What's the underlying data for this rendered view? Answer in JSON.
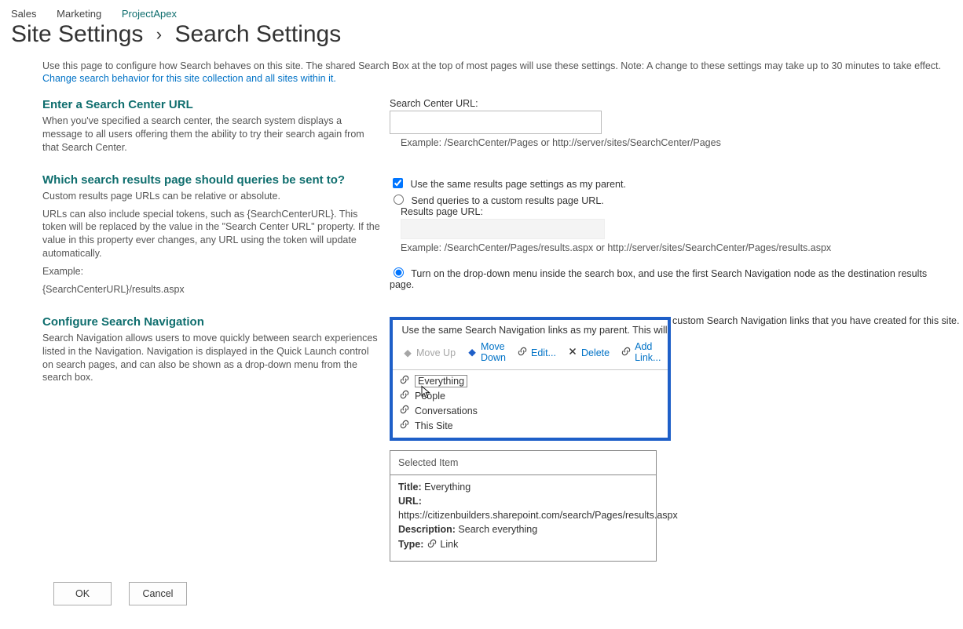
{
  "breadcrumbs": {
    "a": "Sales",
    "b": "Marketing",
    "c": "ProjectApex"
  },
  "title": {
    "main": "Site Settings",
    "sep": "›",
    "sub": "Search Settings"
  },
  "intro": {
    "line1": "Use this page to configure how Search behaves on this site. The shared Search Box at the top of most pages will use these settings. Note: A change to these settings may take up to 30 minutes to take effect.",
    "line2": "Change search behavior for this site collection and all sites within it."
  },
  "sec1": {
    "title": "Enter a Search Center URL",
    "text": "When you've specified a search center, the search system displays a message to all users offering them the ability to try their search again from that Search Center.",
    "fieldLabel": "Search Center URL:",
    "example": "Example: /SearchCenter/Pages or http://server/sites/SearchCenter/Pages"
  },
  "sec2": {
    "title": "Which search results page should queries be sent to?",
    "text1": "Custom results page URLs can be relative or absolute.",
    "text2": "URLs can also include special tokens, such as {SearchCenterURL}. This token will be replaced by the value in the \"Search Center URL\" property. If the value in this property ever changes, any URL using the token will update automatically.",
    "text3": "Example:",
    "text4": "{SearchCenterURL}/results.aspx",
    "opt1": "Use the same results page settings as my parent.",
    "opt2": "Send queries to a custom results page URL.",
    "resultsLabel": "Results page URL:",
    "example": "Example: /SearchCenter/Pages/results.aspx or http://server/sites/SearchCenter/Pages/results.aspx",
    "opt3": "Turn on the drop-down menu inside the search box, and use the first Search Navigation node as the destination results page."
  },
  "sec3": {
    "title": "Configure Search Navigation",
    "text": "Search Navigation allows users to move quickly between search experiences listed in the Navigation. Navigation is displayed in the Quick Launch control on search pages, and can also be shown as a drop-down menu from the search box.",
    "overlapText": "Use the same Search Navigation links as my parent. This will delete all",
    "afterText": "custom Search Navigation links that you have created for this site."
  },
  "toolbar": {
    "moveUp": "Move Up",
    "moveDown1": "Move",
    "moveDown2": "Down",
    "edit": "Edit...",
    "delete": "Delete",
    "add1": "Add",
    "add2": "Link..."
  },
  "navItems": {
    "i0": "Everything",
    "i1": "People",
    "i2": "Conversations",
    "i3": "This Site"
  },
  "selected": {
    "header": "Selected Item",
    "titleK": "Title:",
    "titleV": "Everything",
    "urlK": "URL:",
    "urlV": "https://citizenbuilders.sharepoint.com/search/Pages/results.aspx",
    "descK": "Description:",
    "descV": "Search everything",
    "typeK": "Type:",
    "typeV": "Link"
  },
  "buttons": {
    "ok": "OK",
    "cancel": "Cancel"
  }
}
